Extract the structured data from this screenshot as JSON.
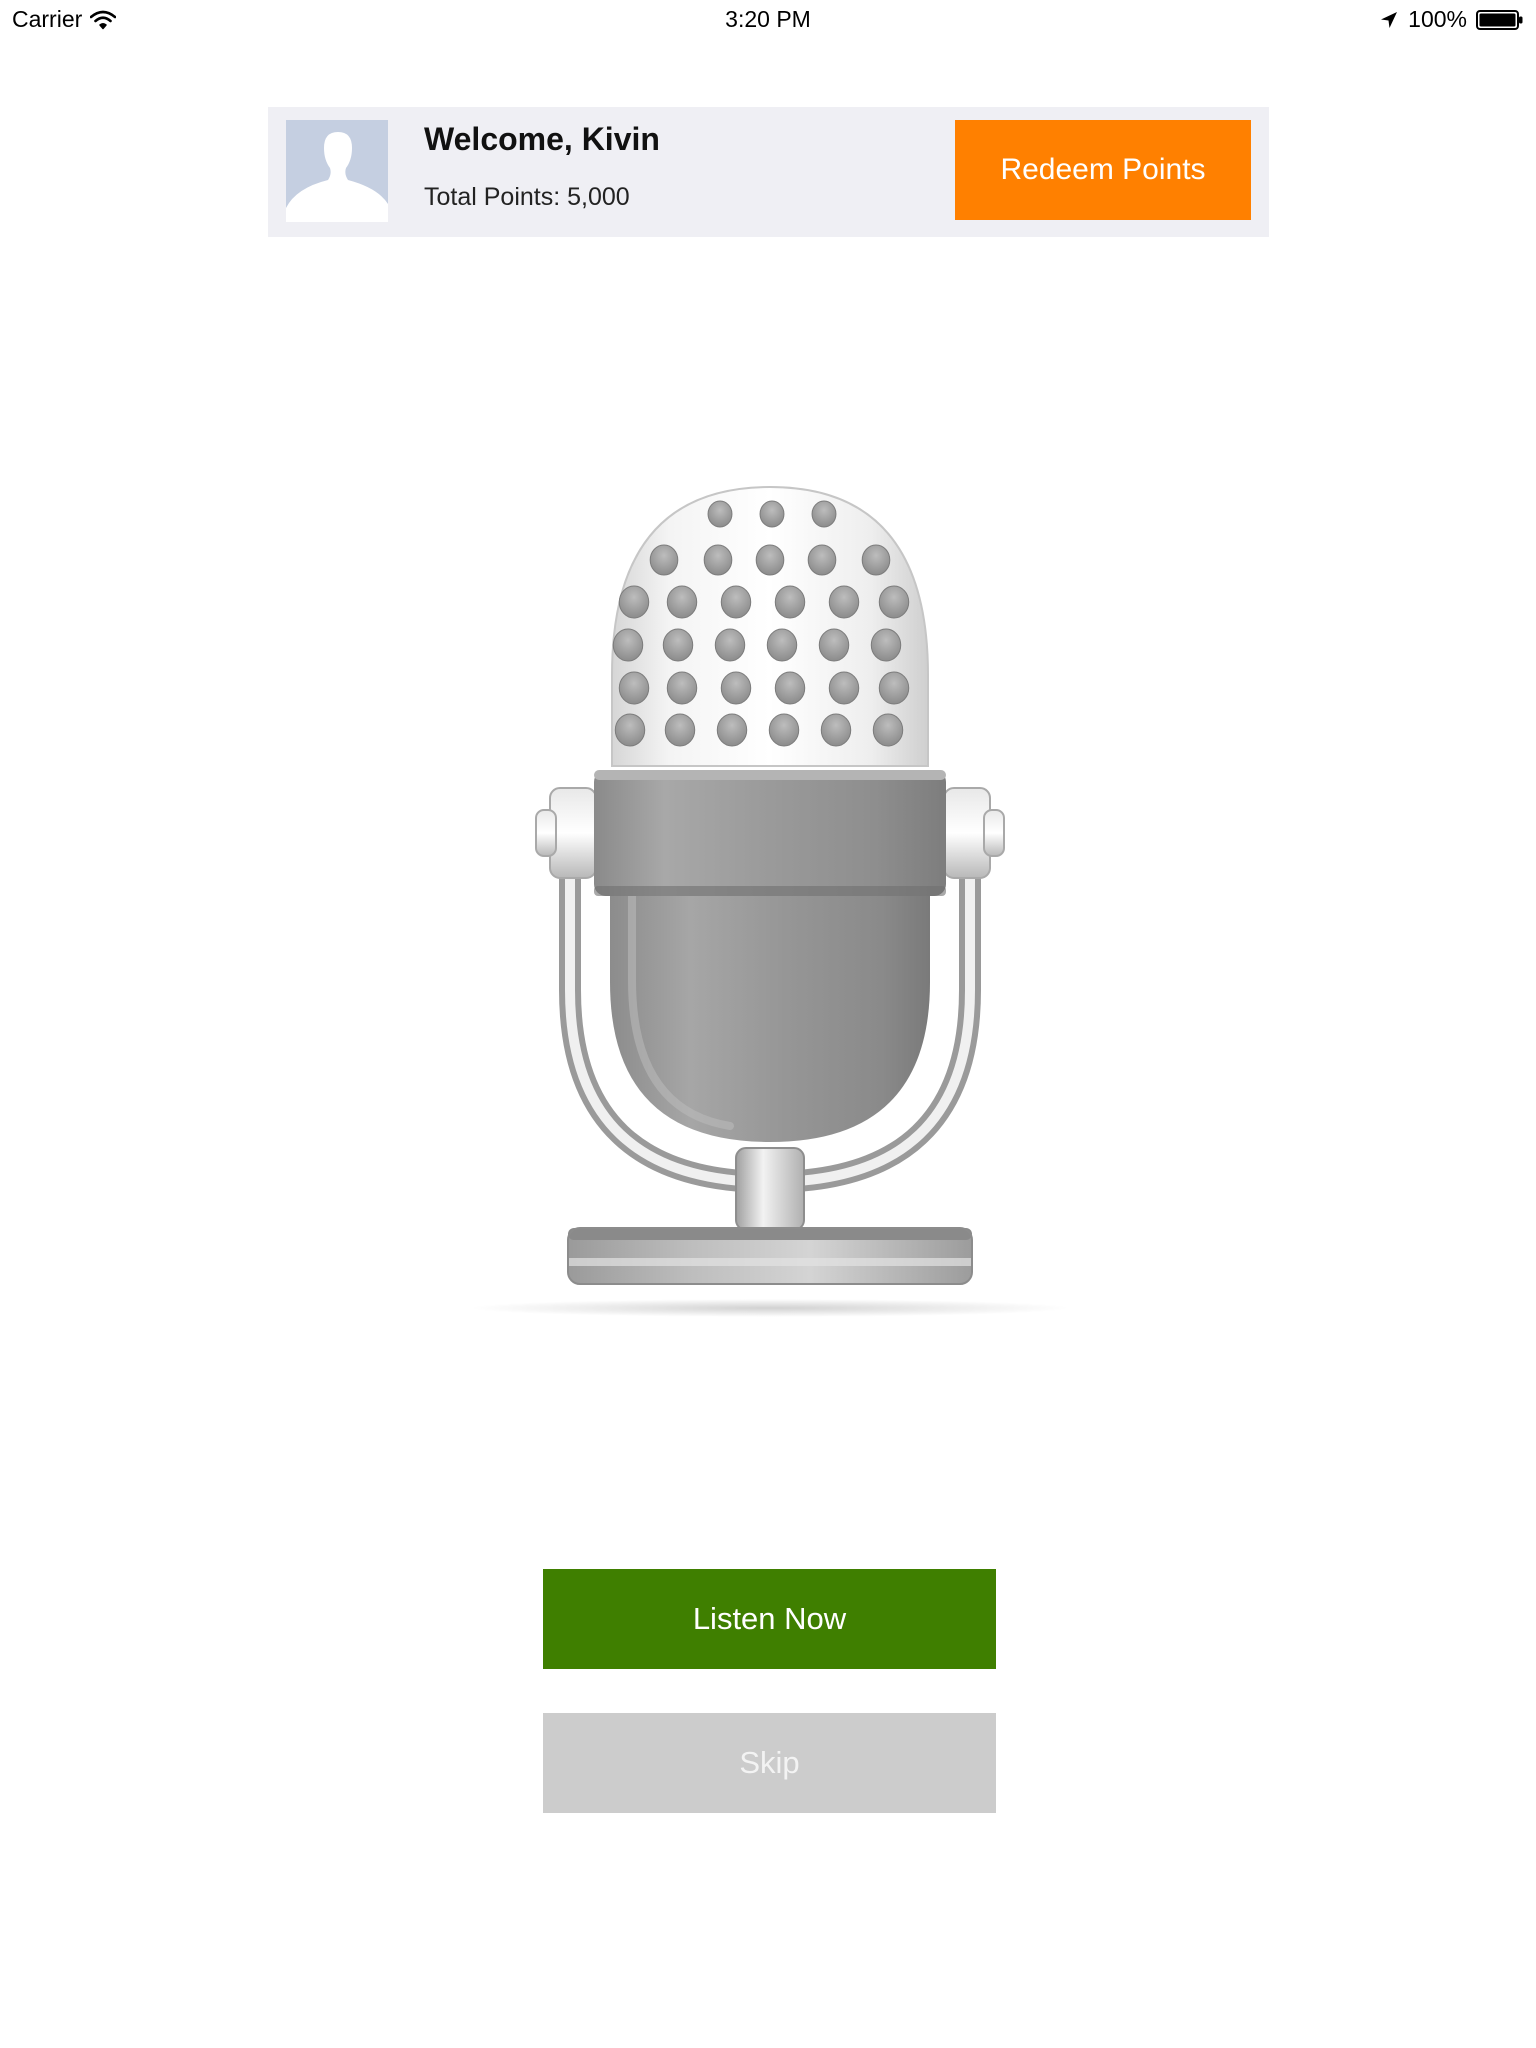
{
  "status_bar": {
    "carrier": "Carrier",
    "time": "3:20 PM",
    "battery": "100%",
    "icons": [
      "wifi-icon",
      "location-arrow-icon",
      "battery-icon"
    ]
  },
  "header": {
    "welcome": "Welcome, Kivin",
    "points": "Total Points: 5,000",
    "redeem_label": "Redeem Points",
    "avatar_icon": "user-silhouette-icon"
  },
  "main": {
    "illustration_icon": "microphone-icon",
    "listen_label": "Listen Now",
    "skip_label": "Skip"
  },
  "colors": {
    "redeem": "#ff8000",
    "listen": "#3f7f00",
    "skip": "#cccccc",
    "header_bg": "#efeff4",
    "avatar_bg": "#c5cfe1"
  }
}
